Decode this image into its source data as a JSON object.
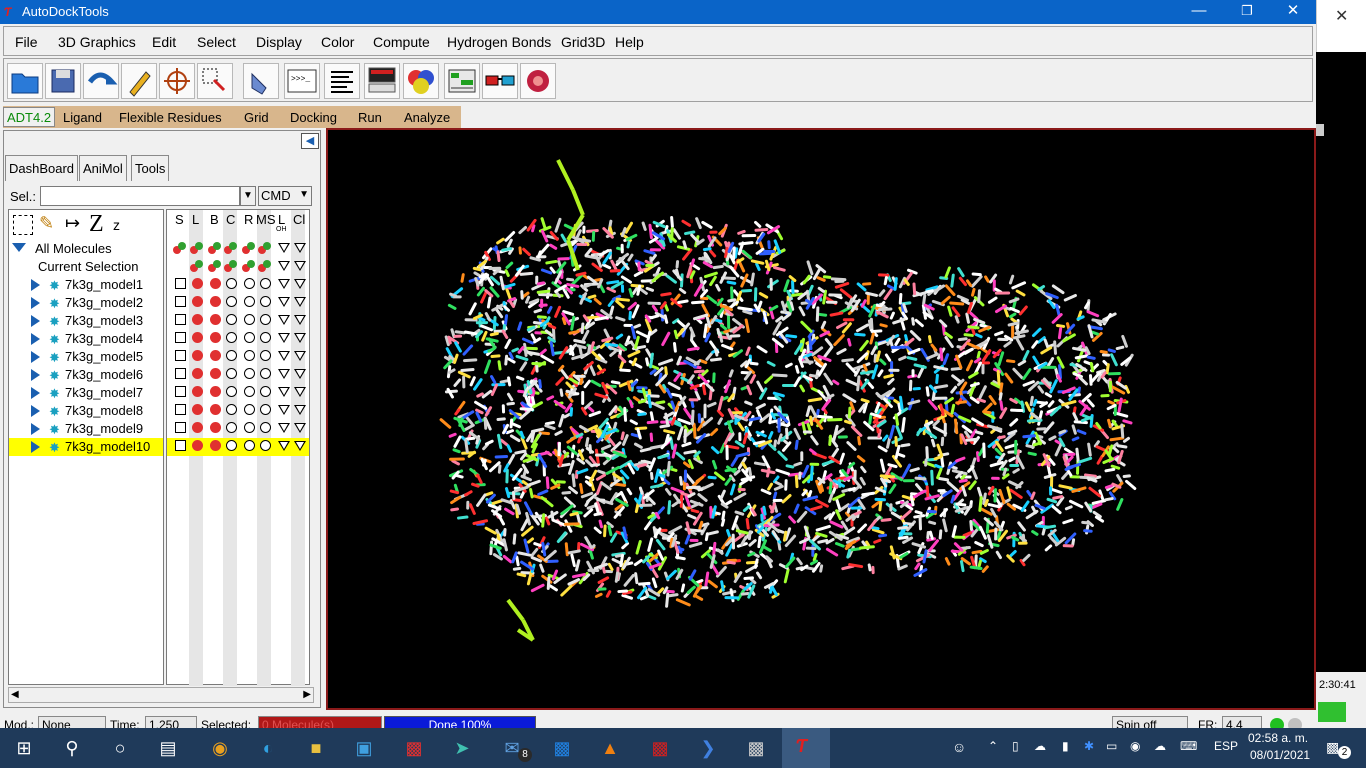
{
  "window": {
    "title": "AutoDockTools",
    "minimize": "—",
    "restore": "❐",
    "close": "✕"
  },
  "menu": [
    "File",
    "3D Graphics",
    "Edit",
    "Select",
    "Display",
    "Color",
    "Compute",
    "Hydrogen Bonds",
    "Grid3D",
    "Help"
  ],
  "toolbar_icons": [
    "open-folder-icon",
    "save-icon",
    "undo-icon",
    "pencil-icon",
    "target-icon",
    "selection-icon",
    "hand-icon",
    "terminal-icon",
    "text-lines-icon",
    "monitor-icon",
    "color-spheres-icon",
    "panel-icon",
    "3d-glasses-icon",
    "render-icon"
  ],
  "module_tabs": [
    "ADT4.2",
    "Ligand",
    "Flexible Residues",
    "Grid",
    "Docking",
    "Run",
    "Analyze"
  ],
  "dash_tabs": [
    "DashBoard",
    "AniMol",
    "Tools"
  ],
  "selection": {
    "label": "Sel.:",
    "value": "",
    "cmd": "CMD"
  },
  "tree": {
    "z_label": "Z",
    "z_small": "z",
    "all_molecules": "All Molecules",
    "current_selection": "Current Selection",
    "molecules": [
      "7k3g_model1",
      "7k3g_model2",
      "7k3g_model3",
      "7k3g_model4",
      "7k3g_model5",
      "7k3g_model6",
      "7k3g_model7",
      "7k3g_model8",
      "7k3g_model9",
      "7k3g_model10"
    ],
    "selected_index": 9
  },
  "columns": [
    "S",
    "L",
    "B",
    "C",
    "R",
    "MS",
    "L",
    "Cl"
  ],
  "column_subs": [
    "",
    "",
    "",
    "",
    "",
    "",
    "OH",
    ""
  ],
  "status": {
    "mod_label": "Mod.:",
    "mod_value": "None",
    "time_label": "Time:",
    "time_value": "1.250",
    "selected_label": "Selected:",
    "selected_value": "0 Molecule(s)",
    "progress_text": "Done 100%",
    "progress": 1.0,
    "spin": "Spin off",
    "fr_label": "FR:",
    "fr_value": "4.4"
  },
  "right_clock": "2:30:41",
  "taskbar": {
    "language": "ESP",
    "time": "02:58 a. m.",
    "date": "08/01/2021",
    "notifications": "2",
    "mail_badge": "8"
  },
  "colors": {
    "title_blue": "#0a64c8",
    "module_bar": "#d8b68c",
    "viewer_border": "#8b1a1a",
    "highlight": "#ffff00",
    "taskbar": "#1f3a5a"
  }
}
